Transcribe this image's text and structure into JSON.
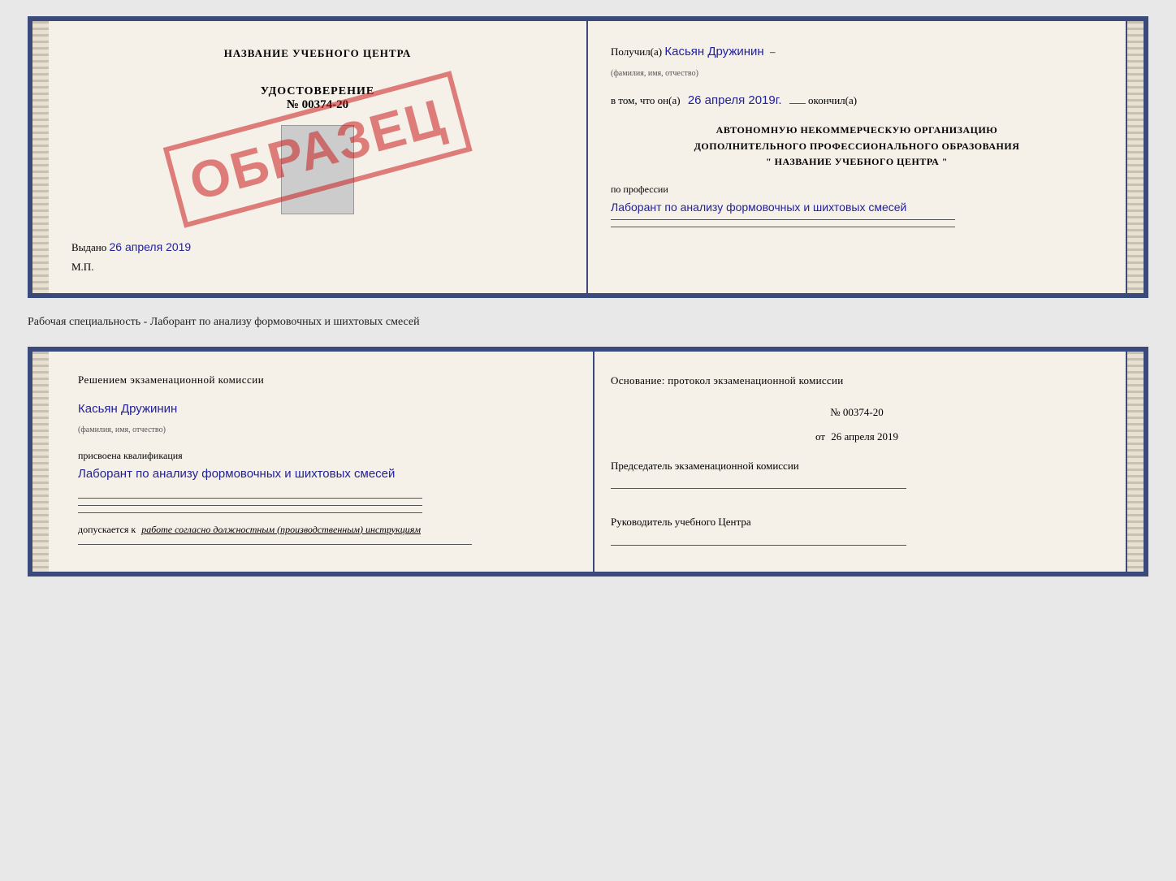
{
  "top_doc": {
    "left": {
      "title": "НАЗВАНИЕ УЧЕБНОГО ЦЕНТРА",
      "stamp_text": "ОБРАЗЕЦ",
      "cert_label": "УДОСТОВЕРЕНИЕ",
      "cert_number": "№ 00374-20",
      "issued_label": "Выдано",
      "issued_date": "26 апреля 2019",
      "mp_label": "М.П."
    },
    "right": {
      "received_prefix": "Получил(а)",
      "received_name": "Касьян Дружинин",
      "name_sublabel": "(фамилия, имя, отчество)",
      "vtom_prefix": "в том, что он(а)",
      "vtom_date": "26 апреля 2019г.",
      "vtom_suffix": "окончил(а)",
      "org_line1": "АВТОНОМНУЮ НЕКОММЕРЧЕСКУЮ ОРГАНИЗАЦИЮ",
      "org_line2": "ДОПОЛНИТЕЛЬНОГО ПРОФЕССИОНАЛЬНОГО ОБРАЗОВАНИЯ",
      "org_line3": "\"  НАЗВАНИЕ УЧЕБНОГО ЦЕНТРА  \"",
      "profession_prefix": "по профессии",
      "profession_text": "Лаборант по анализу формовочных и шихтовых смесей"
    }
  },
  "separator": {
    "text": "Рабочая специальность - Лаборант по анализу формовочных и шихтовых смесей"
  },
  "bottom_doc": {
    "left": {
      "decision_label": "Решением экзаменационной комиссии",
      "person_name": "Касьян Дружинин",
      "name_sublabel": "(фамилия, имя, отчество)",
      "qualification_prefix": "присвоена квалификация",
      "qualification_text": "Лаборант по анализу формовочных и шихтовых смесей",
      "allowed_prefix": "допускается к",
      "allowed_text": "работе согласно должностным (производственным) инструкциям"
    },
    "right": {
      "basis_label": "Основание: протокол экзаменационной комиссии",
      "protocol_number": "№ 00374-20",
      "protocol_date_prefix": "от",
      "protocol_date": "26 апреля 2019",
      "chairman_label": "Председатель экзаменационной комиссии",
      "director_label": "Руководитель учебного Центра"
    }
  }
}
